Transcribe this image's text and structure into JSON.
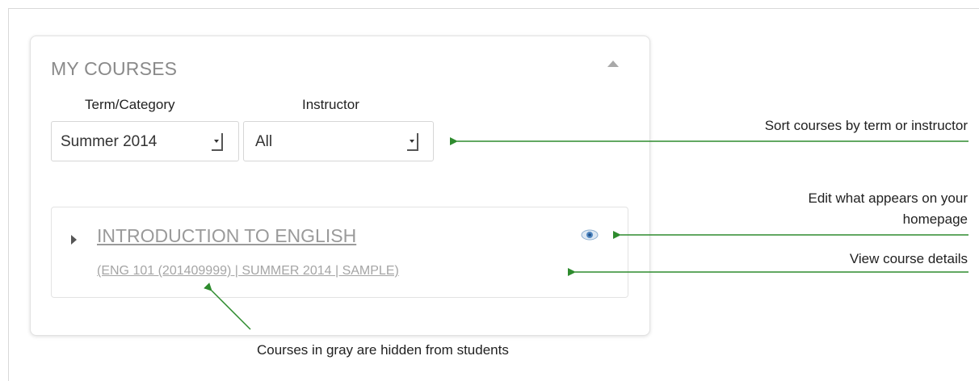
{
  "panel": {
    "title": "MY COURSES",
    "collapse_icon": "chevron-up-icon"
  },
  "filters": {
    "term_label": "Term/Category",
    "term_value": "Summer 2014",
    "instructor_label": "Instructor",
    "instructor_value": "All"
  },
  "course": {
    "title": "INTRODUCTION TO ENGLISH",
    "meta": "(ENG 101 (201409999)  |  SUMMER 2014  |  SAMPLE)",
    "expand_icon": "triangle-right-icon",
    "visibility_icon": "eye-icon"
  },
  "annotations": {
    "sort": "Sort courses by term or instructor",
    "edit_line1": "Edit what appears on your",
    "edit_line2": "homepage",
    "view": "View course details",
    "gray": "Courses in gray are hidden from students"
  },
  "colors": {
    "annotation_arrow": "#2e8b2e",
    "hidden_course_text": "#9a9a9a"
  }
}
